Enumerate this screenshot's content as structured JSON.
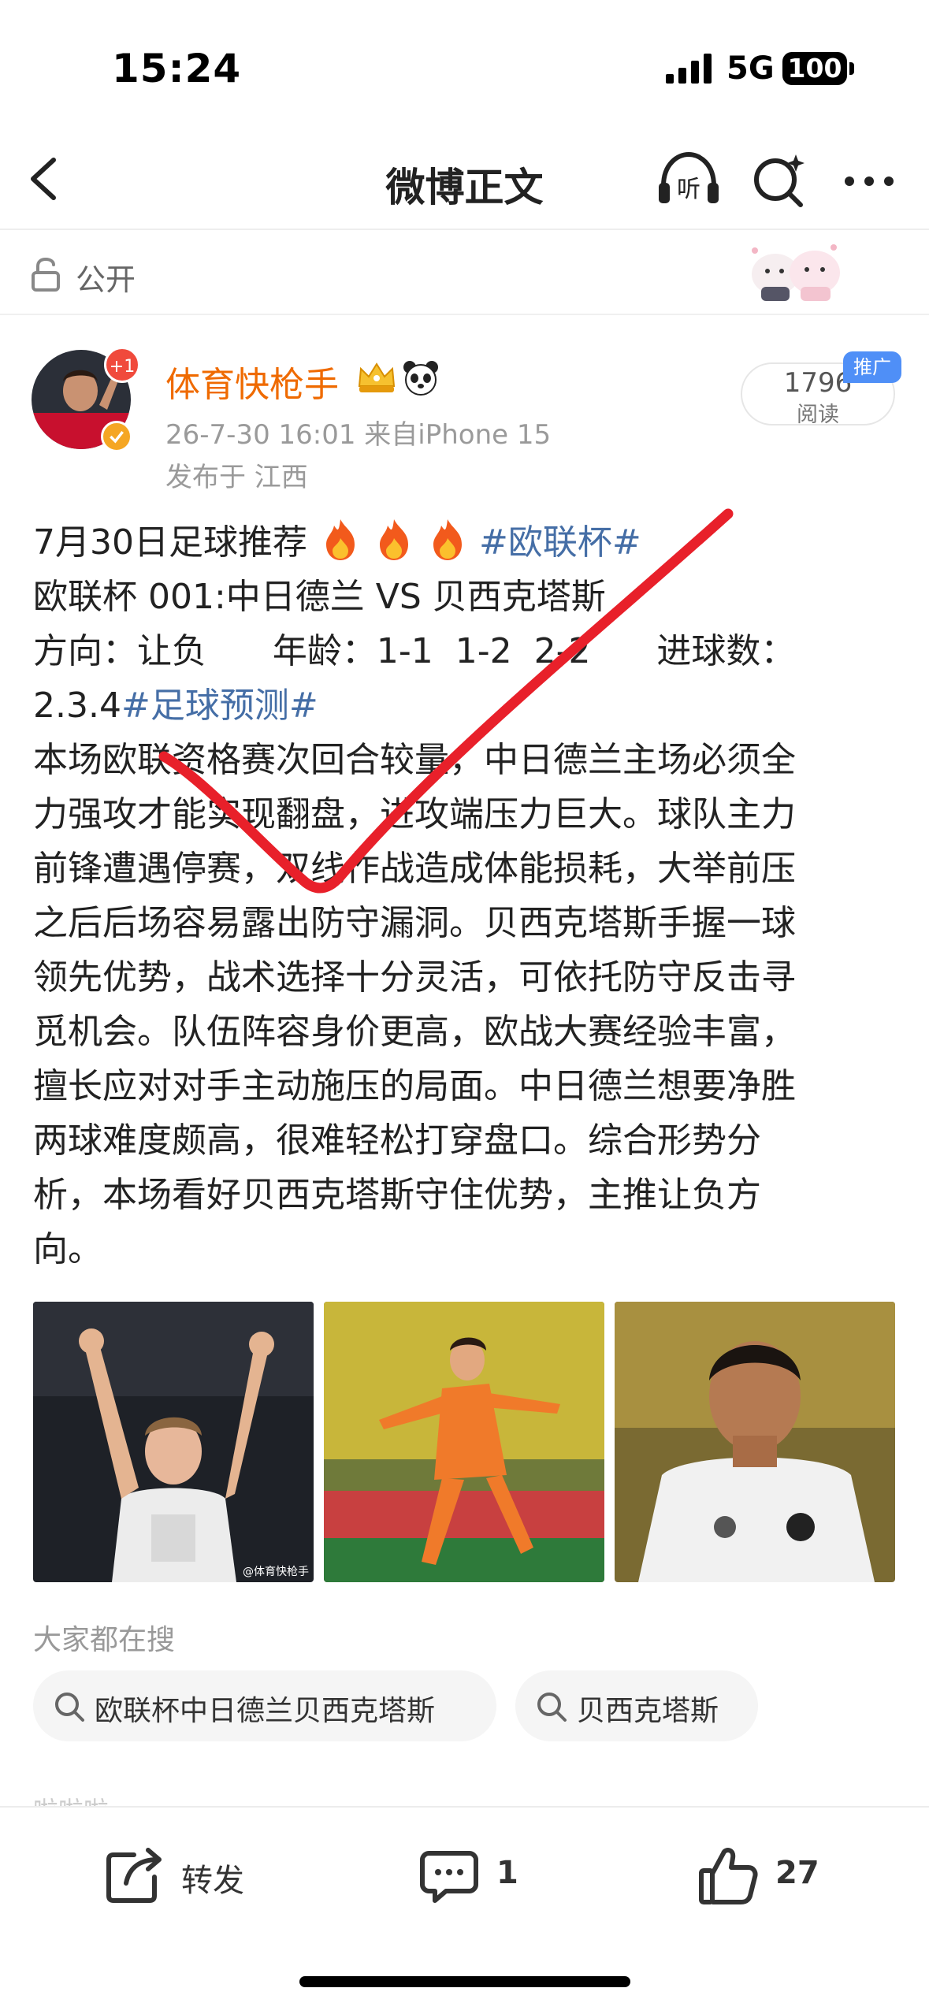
{
  "status_bar": {
    "time": "15:24",
    "network": "5G",
    "battery": "100"
  },
  "nav": {
    "title": "微博正文",
    "listen_label": "听"
  },
  "visibility": {
    "label": "公开"
  },
  "author": {
    "name": "体育快枪手",
    "avatar_badge": "+1",
    "meta": "26-7-30 16:01  来自iPhone 15",
    "location": "发布于 江西"
  },
  "read_stats": {
    "count": "1796",
    "label": "阅读",
    "promo_tag": "推广"
  },
  "post": {
    "line1_text": "7月30日足球推荐",
    "line1_hashtag": "#欧联杯#",
    "line2": "欧联杯 001:中日德兰 VS 贝西克塔斯",
    "line3": "方向：让负      年龄：1-1  1-2  2-2      进球数：",
    "line4_text": "2.3.4",
    "line4_hashtag": "#足球预测#",
    "paragraph_lines": [
      "本场欧联资格赛次回合较量，中日德兰主场必须全",
      "力强攻才能实现翻盘，进攻端压力巨大。球队主力",
      "前锋遭遇停赛，双线作战造成体能损耗，大举前压",
      "之后后场容易露出防守漏洞。贝西克塔斯手握一球",
      "领先优势，战术选择十分灵活，可依托防守反击寻",
      "觅机会。队伍阵容身价更高，欧战大赛经验丰富，",
      "擅长应对对手主动施压的局面。中日德兰想要净胜",
      "两球难度颇高，很难轻松打穿盘口。综合形势分",
      "析，本场看好贝西克塔斯守住优势，主推让负方",
      "向。"
    ]
  },
  "images": {
    "watermark": "@体育快枪手"
  },
  "search": {
    "title": "大家都在搜",
    "chips": [
      "欧联杯中日德兰贝西克塔斯",
      "贝西克塔斯"
    ],
    "next_section_peek": "啦啦啦"
  },
  "actions": {
    "repost_label": "转发",
    "comment_count": "1",
    "like_count": "27"
  },
  "colors": {
    "author_name": "#ef6a00",
    "hashtag": "#456ea6",
    "checkmark": "#e8202a",
    "promo": "#4f8ff7"
  }
}
